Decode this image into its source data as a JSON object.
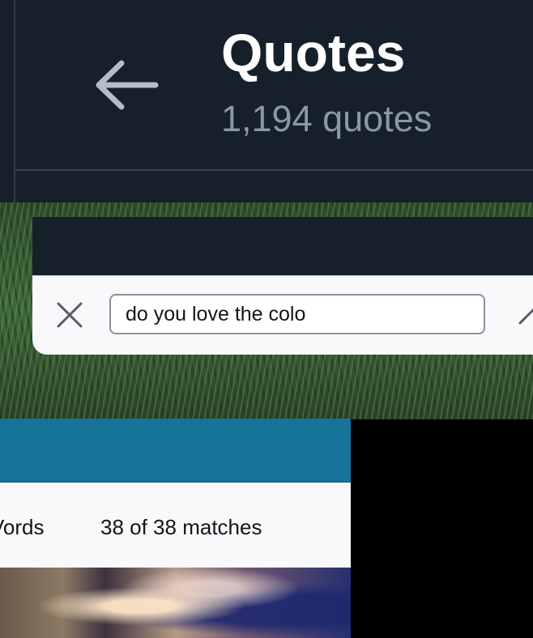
{
  "header": {
    "title": "Quotes",
    "subtitle": "1,194 quotes"
  },
  "find_bar": {
    "input_value": "do you love the colo"
  },
  "find_status": {
    "words_label": "Vords",
    "matches_label": "38 of 38 matches"
  },
  "colors": {
    "header_bg": "#15202b",
    "find_bar_bg": "#f9f9fb",
    "accent_blue": "#17739a"
  },
  "icons": {
    "back": "arrow-left-icon",
    "close": "close-icon",
    "up": "chevron-up-icon"
  }
}
